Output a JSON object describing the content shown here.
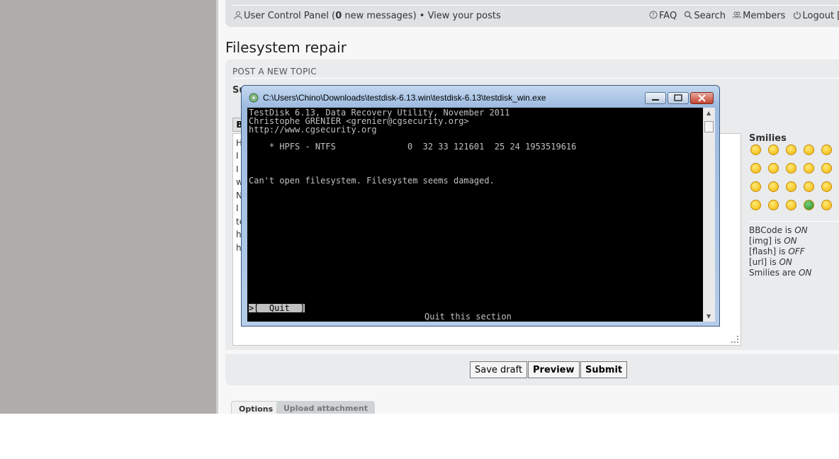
{
  "nav": {
    "ucp": "User Control Panel",
    "msg_open": " (",
    "msg_count": "0",
    "msg_rest": " new messages) •",
    "view_posts": "View your posts",
    "faq": "FAQ",
    "search": "Search",
    "members": "Members",
    "logout": "Logout [ chi"
  },
  "page_title": "Filesystem repair",
  "form": {
    "heading": "POST A NEW TOPIC",
    "subject_label": "Su",
    "bold_button": "B",
    "editor_lines": [
      "H",
      "I",
      "I",
      "w",
      "N",
      "I",
      "te",
      "h",
      "h"
    ]
  },
  "smilies": {
    "title": "Smilies",
    "icons": [
      "very-happy-icon",
      "smile-icon",
      "wink-icon",
      "cool-icon",
      "surprised-icon",
      "confused-icon",
      "sunglasses-icon",
      "laughing-icon",
      "mad-icon",
      "razz-icon",
      "embarrassed-icon",
      "evil-icon",
      "twisted-icon",
      "rolleyes-icon",
      "exclaim-icon",
      "idea-icon",
      "arrow-icon",
      "neutral-icon",
      "green-icon",
      "geek-icon"
    ]
  },
  "bbcode": {
    "bbcode_label": "BBCode is ",
    "bbcode_val": "ON",
    "img_label": "[img] is ",
    "img_val": "ON",
    "flash_label": "[flash] is ",
    "flash_val": "OFF",
    "url_label": "[url] is ",
    "url_val": "ON",
    "smilies_label": "Smilies are ",
    "smilies_val": "ON"
  },
  "buttons": {
    "save_draft": "Save draft",
    "preview": "Preview",
    "submit": "Submit"
  },
  "tabs": {
    "options": "Options",
    "upload": "Upload attachment"
  },
  "terminal": {
    "title": "C:\\Users\\Chino\\Downloads\\testdisk-6.13.win\\testdisk-6.13\\testdisk_win.exe",
    "line1": "TestDisk 6.13, Data Recovery Utility, November 2011",
    "line2": "Christophe GRENIER <grenier@cgsecurity.org>",
    "line3": "http://www.cgsecurity.org",
    "partition": "    * HPFS - NTFS              0  32 33 121601  25 24 1953519616",
    "error": "Can't open filesystem. Filesystem seems damaged.",
    "quit_selected": ">[  Quit  ]",
    "status": "Quit this section"
  }
}
